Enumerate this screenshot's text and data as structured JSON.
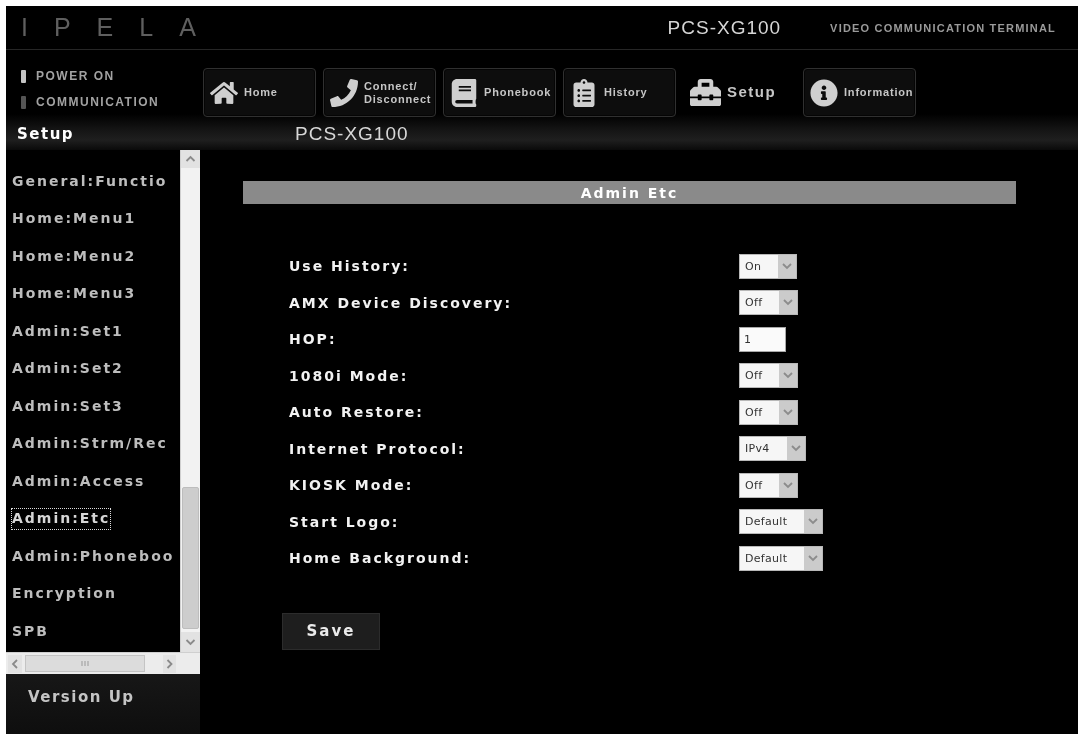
{
  "header": {
    "logo": "IPELA",
    "model": "PCS-XG100",
    "product": "VIDEO COMMUNICATION TERMINAL"
  },
  "status_indicators": [
    {
      "label": "POWER ON",
      "on": true
    },
    {
      "label": "COMMUNICATION",
      "on": false
    }
  ],
  "nav_buttons": [
    {
      "label": "Home",
      "selected": false
    },
    {
      "label": "Connect/ Disconnect",
      "selected": false
    },
    {
      "label": "Phonebook",
      "selected": false
    },
    {
      "label": "History",
      "selected": false
    },
    {
      "label": "Setup",
      "selected": true
    },
    {
      "label": "Information",
      "selected": false
    }
  ],
  "page_title": "Setup",
  "device_name": "PCS-XG100",
  "sidebar": {
    "items": [
      {
        "label": "General:Functio",
        "selected": false
      },
      {
        "label": "Home:Menu1",
        "selected": false
      },
      {
        "label": "Home:Menu2",
        "selected": false
      },
      {
        "label": "Home:Menu3",
        "selected": false
      },
      {
        "label": "Admin:Set1",
        "selected": false
      },
      {
        "label": "Admin:Set2",
        "selected": false
      },
      {
        "label": "Admin:Set3",
        "selected": false
      },
      {
        "label": "Admin:Strm/Rec",
        "selected": false
      },
      {
        "label": "Admin:Access",
        "selected": false
      },
      {
        "label": "Admin:Etc",
        "selected": true
      },
      {
        "label": "Admin:Phoneboo",
        "selected": false
      },
      {
        "label": "Encryption",
        "selected": false
      },
      {
        "label": "SPB",
        "selected": false
      }
    ],
    "footer_link": "Version Up"
  },
  "panel": {
    "title": "Admin Etc",
    "fields": [
      {
        "label": "Use History:",
        "kind": "select",
        "value": "On"
      },
      {
        "label": "AMX Device Discovery:",
        "kind": "select",
        "value": "Off"
      },
      {
        "label": "HOP:",
        "kind": "text",
        "value": "1"
      },
      {
        "label": "1080i Mode:",
        "kind": "select",
        "value": "Off"
      },
      {
        "label": "Auto Restore:",
        "kind": "select",
        "value": "Off"
      },
      {
        "label": "Internet Protocol:",
        "kind": "select",
        "value": "IPv4"
      },
      {
        "label": "KIOSK Mode:",
        "kind": "select",
        "value": "Off"
      },
      {
        "label": "Start Logo:",
        "kind": "select",
        "value": "Default"
      },
      {
        "label": "Home Background:",
        "kind": "select",
        "value": "Default"
      }
    ],
    "save_button": "Save"
  }
}
